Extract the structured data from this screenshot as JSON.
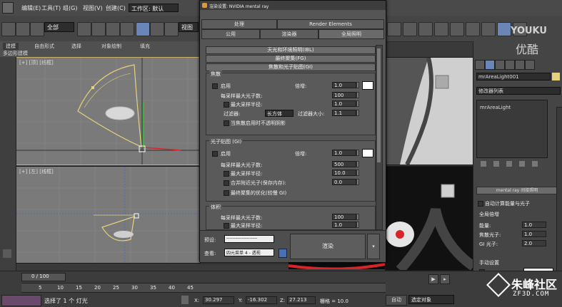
{
  "menubar": {
    "items": [
      "编辑(E)",
      "工具(T)",
      "组(G)",
      "视图(V)",
      "创建(C)",
      "工作区: 默认"
    ]
  },
  "toolbar": {
    "selection_filter": "全部",
    "view_dropdown": "视图"
  },
  "ribbon": {
    "tabs": [
      "建模",
      "自由形式",
      "选择",
      "对象绘制",
      "填充"
    ],
    "subtitle": "多边形建模"
  },
  "viewports": {
    "top_left_label": "[+] [顶] [线框]",
    "bottom_left_label": "[+] [左] [线框]"
  },
  "dialog": {
    "title": "渲染设置: NVIDIA mental ray",
    "tabs_row1": [
      "处理",
      "Render Elements"
    ],
    "tabs_row2": [
      "公用",
      "渲染器",
      "全局照明"
    ],
    "rollouts": [
      "天光和环境照明(IBL)",
      "最终聚集(FG)",
      "焦散和光子贴图(GI)"
    ],
    "caustics": {
      "title": "焦散",
      "enable_label": "启用",
      "multiplier_label": "倍增:",
      "multiplier_value": "1.0",
      "max_photons_label": "每采样最大光子数:",
      "max_photons_value": "100",
      "max_radius_label": "最大采样半径:",
      "max_radius_value": "1.0",
      "filter_label": "过滤器:",
      "filter_value": "长方体",
      "filter_size_label": "过滤器大小:",
      "filter_size_value": "1.1",
      "opaque_shadow_label": "当焦散启用时不透明阴影"
    },
    "gi": {
      "title": "光子贴图 (GI)",
      "enable_label": "启用",
      "multiplier_label": "倍增:",
      "multiplier_value": "1.0",
      "max_photons_label": "每采样最大光子数:",
      "max_photons_value": "500",
      "max_radius_label": "最大采样半径:",
      "max_radius_value": "10.0",
      "merge_label": "合并附近光子(保存内存):",
      "merge_value": "0.0",
      "fg_opt_label": "最终聚集的优化(较慢 GI)"
    },
    "volume": {
      "title": "体积",
      "max_photons_label": "每采样最大光子数:",
      "max_photons_value": "100",
      "max_radius_label": "最大采样半径:",
      "max_radius_value": "1.0"
    },
    "preset_label": "预设:",
    "preset_value": "--------------------",
    "view_label": "查看:",
    "view_value": "四元菜单 4 - 透视",
    "render_button": "渲染"
  },
  "right_panel": {
    "object_name": "mrAreaLight001",
    "modifier_list": "修改器列表",
    "stack_item": "mrAreaLight",
    "rollout_title": "mental ray 间接照明",
    "auto_calc_label": "自动计算能量与光子",
    "global_mult_title": "全局倍增",
    "energy_label": "能量:",
    "energy_value": "1.0",
    "caustic_photons_label": "焦散光子:",
    "caustic_photons_value": "1.0",
    "gi_photons_label": "GI 光子:",
    "gi_photons_value": "2.0",
    "manual_title": "手动设置"
  },
  "timeline": {
    "frame_label": "0 / 100",
    "ticks": [
      "5",
      "10",
      "15",
      "20",
      "25",
      "30",
      "35",
      "40",
      "45"
    ]
  },
  "status": {
    "message": "选择了 1 个 灯光",
    "x_label": "X:",
    "x_value": "30.297",
    "y_label": "Y:",
    "y_value": "-16.302",
    "z_label": "Z:",
    "z_value": "27.213",
    "grid": "栅格 = 10.0",
    "auto_label": "自动",
    "selection_mode": "选定对象"
  },
  "watermarks": {
    "youku_en": "YOUKU",
    "youku_cn": "优酷",
    "site_cn": "朱峰社区",
    "site_url": "ZF3D.COM"
  },
  "colors": {
    "accent_blue": "#4a6fb5",
    "light_yellow": "#e6d27a",
    "gizmo_red": "#d8252b",
    "gizmo_green": "#2ec52e"
  }
}
